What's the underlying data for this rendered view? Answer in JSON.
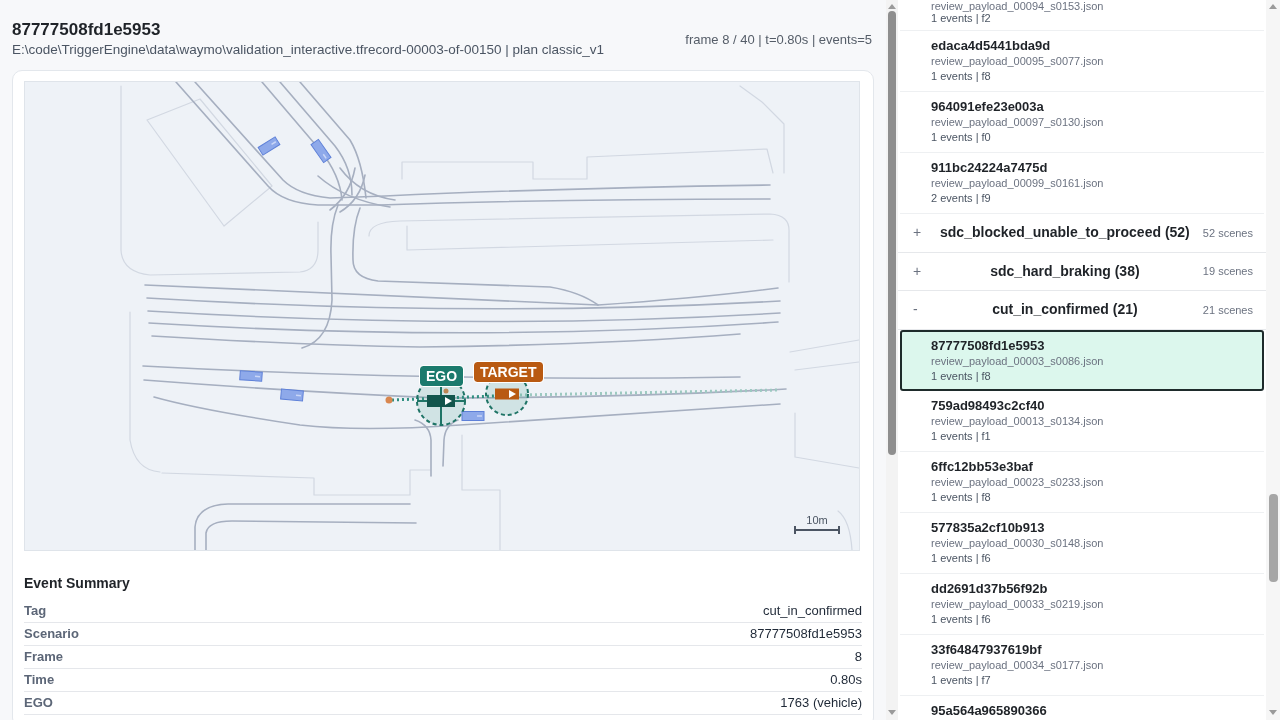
{
  "header": {
    "title": "87777508fd1e5953",
    "path": "E:\\code\\TriggerEngine\\data\\waymo\\validation_interactive.tfrecord-00003-of-00150 | plan classic_v1",
    "meta": "frame 8 / 40 | t=0.80s | events=5"
  },
  "map": {
    "agents": [
      {
        "kind": "ego",
        "label": "EGO",
        "color": "#1b7a6d"
      },
      {
        "kind": "target",
        "label": "TARGET",
        "color": "#b95a12"
      }
    ],
    "scale": "10m"
  },
  "event_summary": {
    "title": "Event Summary",
    "rows": [
      {
        "label": "Tag",
        "value": "cut_in_confirmed"
      },
      {
        "label": "Scenario",
        "value": "87777508fd1e5953"
      },
      {
        "label": "Frame",
        "value": "8"
      },
      {
        "label": "Time",
        "value": "0.80s"
      },
      {
        "label": "EGO",
        "value": "1763 (vehicle)"
      }
    ]
  },
  "scene_list": [
    {
      "kind": "scene",
      "file": "review_payload_00094_s0153.json",
      "events": "1 events | f2",
      "selected": false
    },
    {
      "kind": "scene",
      "name": "edaca4d5441bda9d",
      "file": "review_payload_00095_s0077.json",
      "events": "1 events | f8",
      "selected": false
    },
    {
      "kind": "scene",
      "name": "964091efe23e003a",
      "file": "review_payload_00097_s0130.json",
      "events": "1 events | f0",
      "selected": false
    },
    {
      "kind": "scene",
      "name": "911bc24224a7475d",
      "file": "review_payload_00099_s0161.json",
      "events": "2 events | f9",
      "selected": false
    },
    {
      "kind": "group",
      "toggle": "+",
      "title": "sdc_blocked_unable_to_proceed (52)",
      "count": "52 scenes"
    },
    {
      "kind": "group",
      "toggle": "+",
      "title": "sdc_hard_braking (38)",
      "count": "19 scenes"
    },
    {
      "kind": "group",
      "toggle": "-",
      "title": "cut_in_confirmed (21)",
      "count": "21 scenes",
      "children": [
        {
          "kind": "scene",
          "name": "87777508fd1e5953",
          "file": "review_payload_00003_s0086.json",
          "events": "1 events | f8",
          "selected": true
        },
        {
          "kind": "scene",
          "name": "759ad98493c2cf40",
          "file": "review_payload_00013_s0134.json",
          "events": "1 events | f1",
          "selected": false
        },
        {
          "kind": "scene",
          "name": "6ffc12bb53e3baf",
          "file": "review_payload_00023_s0233.json",
          "events": "1 events | f8",
          "selected": false
        },
        {
          "kind": "scene",
          "name": "577835a2cf10b913",
          "file": "review_payload_00030_s0148.json",
          "events": "1 events | f6",
          "selected": false
        },
        {
          "kind": "scene",
          "name": "dd2691d37b56f92b",
          "file": "review_payload_00033_s0219.json",
          "events": "1 events | f6",
          "selected": false
        },
        {
          "kind": "scene",
          "name": "33f64847937619bf",
          "file": "review_payload_00034_s0177.json",
          "events": "1 events | f7",
          "selected": false
        },
        {
          "kind": "scene",
          "name": "95a564a965890366",
          "selected": false
        }
      ]
    }
  ]
}
